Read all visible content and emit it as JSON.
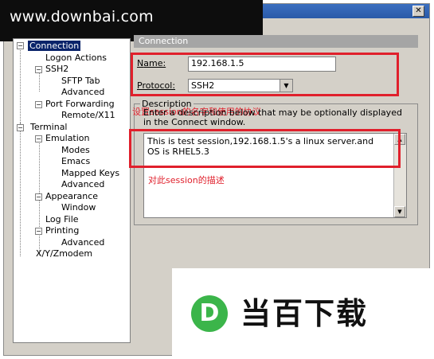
{
  "watermark": {
    "site": "www.downbai.com",
    "logo_letter": "D",
    "logo_name": "当百下载"
  },
  "window": {
    "close_glyph": "✕"
  },
  "tree": {
    "items": [
      {
        "label": "Connection"
      },
      {
        "label": "Logon Actions"
      },
      {
        "label": "SSH2"
      },
      {
        "label": "SFTP Tab"
      },
      {
        "label": "Advanced"
      },
      {
        "label": "Port Forwarding"
      },
      {
        "label": "Remote/X11"
      },
      {
        "label": "Terminal"
      },
      {
        "label": "Emulation"
      },
      {
        "label": "Modes"
      },
      {
        "label": "Emacs"
      },
      {
        "label": "Mapped Keys"
      },
      {
        "label": "Advanced"
      },
      {
        "label": "Appearance"
      },
      {
        "label": "Window"
      },
      {
        "label": "Log File"
      },
      {
        "label": "Printing"
      },
      {
        "label": "Advanced"
      },
      {
        "label": "X/Y/Zmodem"
      }
    ]
  },
  "panel": {
    "section_title": "Connection",
    "name_label_key": "N",
    "name_label_rest": "ame:",
    "name_value": "192.168.1.5",
    "protocol_label_key": "P",
    "protocol_label_rest": "rotocol:",
    "protocol_value": "SSH2",
    "description_group_title": "Description",
    "description_help": "Enter a description below that may be optionally displayed in the Connect window.",
    "description_value": "This is test session,192.168.1.5's a linux server.and OS is RHEL5.3"
  },
  "annotations": {
    "session_name_note": "设置session的名字和使用的协议",
    "session_desc_note": "对此session的描述",
    "accent_color": "#e0202c"
  }
}
